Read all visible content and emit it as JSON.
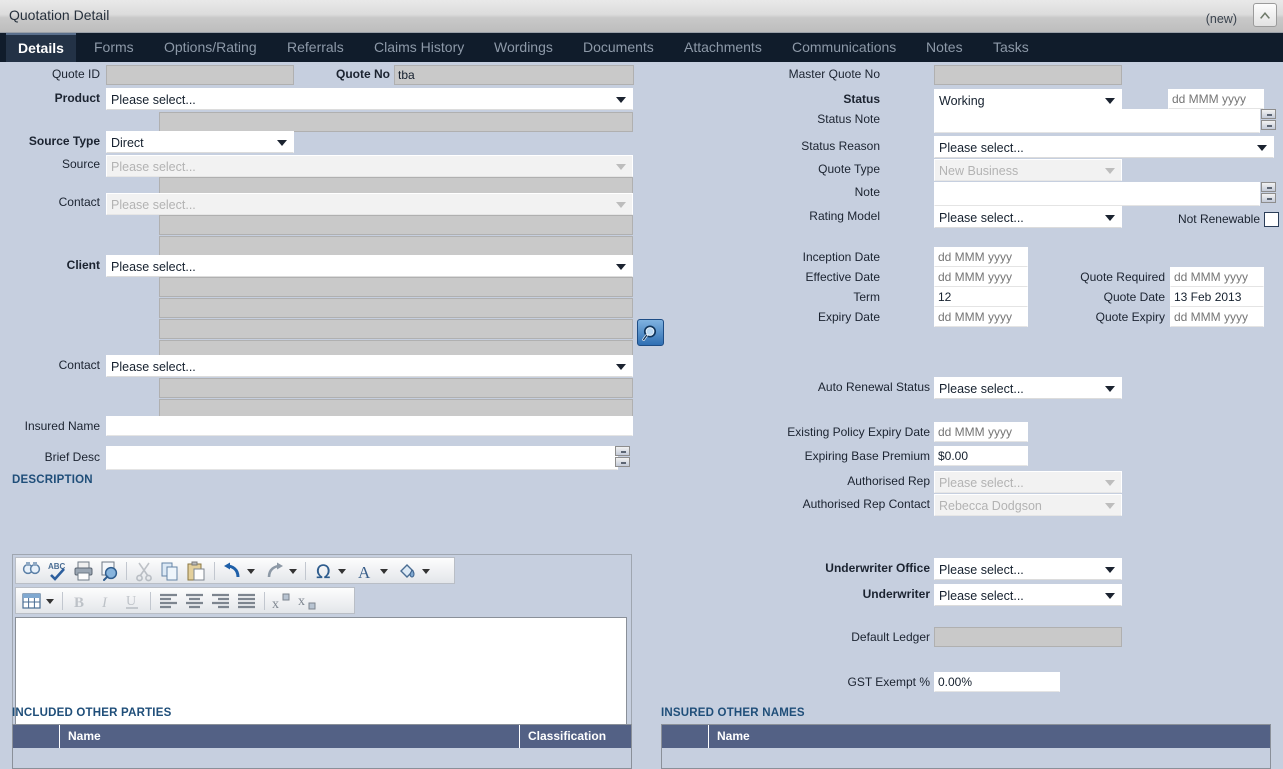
{
  "window": {
    "title": "Quotation Detail",
    "state_label": "(new)",
    "collapse_icon": "chevron-up-icon"
  },
  "tabs": [
    {
      "label": "Details",
      "active": true
    },
    {
      "label": "Forms",
      "active": false
    },
    {
      "label": "Options/Rating",
      "active": false
    },
    {
      "label": "Referrals",
      "active": false
    },
    {
      "label": "Claims History",
      "active": false
    },
    {
      "label": "Wordings",
      "active": false
    },
    {
      "label": "Documents",
      "active": false
    },
    {
      "label": "Attachments",
      "active": false
    },
    {
      "label": "Communications",
      "active": false
    },
    {
      "label": "Notes",
      "active": false
    },
    {
      "label": "Tasks",
      "active": false
    }
  ],
  "left": {
    "quote_id": {
      "label": "Quote ID",
      "value": ""
    },
    "product": {
      "label": "Product",
      "value": "Please select...",
      "sub_value": ""
    },
    "source_type": {
      "label": "Source Type",
      "value": "Direct"
    },
    "source": {
      "label": "Source",
      "value": "Please select...",
      "sub_value": ""
    },
    "contact_source": {
      "label": "Contact",
      "value": "Please select...",
      "sub1": "",
      "sub2": ""
    },
    "client": {
      "label": "Client",
      "value": "Please select...",
      "sub1": "",
      "sub2": "",
      "sub3": "",
      "sub4": "",
      "search_icon": "magnifier-icon"
    },
    "contact_client": {
      "label": "Contact",
      "value": "Please select...",
      "sub1": "",
      "sub2": ""
    },
    "insured_name": {
      "label": "Insured Name",
      "value": ""
    },
    "brief_desc": {
      "label": "Brief Desc",
      "value": ""
    }
  },
  "right": {
    "quote_no": {
      "label": "Quote No",
      "value": "tba"
    },
    "master_quote_no": {
      "label": "Master Quote No",
      "value": ""
    },
    "status": {
      "label": "Status",
      "value": "Working"
    },
    "status_date": {
      "label": "",
      "placeholder": "dd MMM yyyy",
      "value": ""
    },
    "status_note": {
      "label": "Status Note",
      "value": ""
    },
    "status_reason": {
      "label": "Status Reason",
      "value": "Please select..."
    },
    "quote_type": {
      "label": "Quote Type",
      "value": "New Business",
      "disabled": true
    },
    "note": {
      "label": "Note",
      "value": ""
    },
    "rating_model": {
      "label": "Rating Model",
      "value": "Please select..."
    },
    "not_renewable": {
      "label": "Not Renewable",
      "checked": false
    },
    "inception_date": {
      "label": "Inception Date",
      "placeholder": "dd MMM yyyy",
      "value": ""
    },
    "effective_date": {
      "label": "Effective Date",
      "placeholder": "dd MMM yyyy",
      "value": ""
    },
    "term": {
      "label": "Term",
      "value": "12"
    },
    "expiry_date": {
      "label": "Expiry Date",
      "placeholder": "dd MMM yyyy",
      "value": ""
    },
    "quote_required": {
      "label": "Quote Required",
      "placeholder": "dd MMM yyyy",
      "value": ""
    },
    "quote_date": {
      "label": "Quote Date",
      "value": "13 Feb 2013"
    },
    "quote_expiry": {
      "label": "Quote Expiry",
      "placeholder": "dd MMM yyyy",
      "value": ""
    },
    "auto_renewal_status": {
      "label": "Auto Renewal Status",
      "value": "Please select..."
    },
    "existing_policy_expiry": {
      "label": "Existing Policy Expiry Date",
      "placeholder": "dd MMM yyyy",
      "value": ""
    },
    "expiring_base_premium": {
      "label": "Expiring Base Premium",
      "value": "$0.00"
    },
    "authorised_rep": {
      "label": "Authorised Rep",
      "value": "Please select...",
      "disabled": true
    },
    "authorised_rep_contact": {
      "label": "Authorised Rep Contact",
      "value": "Rebecca Dodgson",
      "disabled": true
    },
    "underwriter_office": {
      "label": "Underwriter Office",
      "value": "Please select..."
    },
    "underwriter": {
      "label": "Underwriter",
      "value": "Please select..."
    },
    "default_ledger": {
      "label": "Default Ledger",
      "value": ""
    },
    "gst_exempt": {
      "label": "GST Exempt %",
      "value": "0.00%"
    }
  },
  "description": {
    "heading": "DESCRIPTION",
    "body_text": "",
    "toolbar_row1": [
      {
        "name": "find-icon",
        "title": "Find"
      },
      {
        "name": "spellcheck-icon",
        "title": "Spelling"
      },
      {
        "name": "print-icon",
        "title": "Print"
      },
      {
        "name": "print-preview-icon",
        "title": "Print Preview"
      },
      {
        "name": "cut-icon",
        "title": "Cut",
        "disabled": true
      },
      {
        "name": "copy-icon",
        "title": "Copy"
      },
      {
        "name": "paste-icon",
        "title": "Paste"
      },
      {
        "name": "undo-icon",
        "title": "Undo"
      },
      {
        "name": "redo-icon",
        "title": "Redo"
      },
      {
        "name": "symbol-icon",
        "title": "Insert Symbol"
      },
      {
        "name": "font-color-icon",
        "title": "Font Color"
      },
      {
        "name": "highlight-color-icon",
        "title": "Highlight Color"
      }
    ],
    "toolbar_row2": [
      {
        "name": "table-icon",
        "title": "Insert Table"
      },
      {
        "name": "bold-icon",
        "title": "Bold",
        "disabled": true
      },
      {
        "name": "italic-icon",
        "title": "Italic",
        "disabled": true
      },
      {
        "name": "underline-icon",
        "title": "Underline",
        "disabled": true
      },
      {
        "name": "align-left-icon",
        "title": "Align Left"
      },
      {
        "name": "align-center-icon",
        "title": "Align Center"
      },
      {
        "name": "align-right-icon",
        "title": "Align Right"
      },
      {
        "name": "align-justify-icon",
        "title": "Justify"
      },
      {
        "name": "superscript-icon",
        "title": "Superscript"
      },
      {
        "name": "subscript-icon",
        "title": "Subscript"
      }
    ]
  },
  "grids": {
    "included_other_parties": {
      "heading": "INCLUDED OTHER PARTIES",
      "columns": [
        "Name",
        "Classification"
      ],
      "rows": []
    },
    "insured_other_names": {
      "heading": "INSURED OTHER NAMES",
      "columns": [
        "Name"
      ],
      "rows": []
    }
  },
  "colors": {
    "page_background": "#c6cfdf",
    "tabstrip": "#101c2b",
    "active_tab": "#233246",
    "section_heading": "#1f4e79",
    "grid_header": "#536185",
    "readonly_field": "#c9c9c9"
  }
}
